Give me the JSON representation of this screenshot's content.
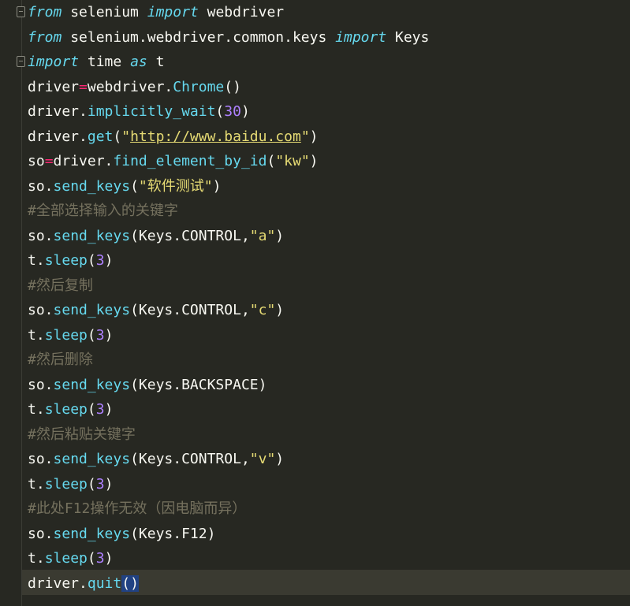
{
  "editor": {
    "lines": [
      [
        {
          "t": "from",
          "c": "kw"
        },
        {
          "t": " selenium "
        },
        {
          "t": "import",
          "c": "kw"
        },
        {
          "t": " webdriver"
        }
      ],
      [
        {
          "t": "from",
          "c": "kw"
        },
        {
          "t": " selenium.webdriver.common.keys "
        },
        {
          "t": "import",
          "c": "kw"
        },
        {
          "t": " Keys"
        }
      ],
      [
        {
          "t": "import",
          "c": "kw"
        },
        {
          "t": " time "
        },
        {
          "t": "as",
          "c": "kw"
        },
        {
          "t": " t"
        }
      ],
      [
        {
          "t": "driver"
        },
        {
          "t": "=",
          "c": "op"
        },
        {
          "t": "webdriver."
        },
        {
          "t": "Chrome",
          "c": "fn"
        },
        {
          "t": "()"
        }
      ],
      [
        {
          "t": "driver."
        },
        {
          "t": "implicitly_wait",
          "c": "fn"
        },
        {
          "t": "("
        },
        {
          "t": "30",
          "c": "num"
        },
        {
          "t": ")"
        }
      ],
      [
        {
          "t": "driver."
        },
        {
          "t": "get",
          "c": "fn"
        },
        {
          "t": "("
        },
        {
          "t": "\"",
          "c": "str"
        },
        {
          "t": "http://www.baidu.com",
          "c": "url"
        },
        {
          "t": "\"",
          "c": "str"
        },
        {
          "t": ")"
        }
      ],
      [
        {
          "t": "so"
        },
        {
          "t": "=",
          "c": "op"
        },
        {
          "t": "driver."
        },
        {
          "t": "find_element_by_id",
          "c": "fn"
        },
        {
          "t": "("
        },
        {
          "t": "\"kw\"",
          "c": "str"
        },
        {
          "t": ")"
        }
      ],
      [
        {
          "t": "so."
        },
        {
          "t": "send_keys",
          "c": "fn"
        },
        {
          "t": "("
        },
        {
          "t": "\"软件测试\"",
          "c": "str"
        },
        {
          "t": ")"
        }
      ],
      [
        {
          "t": "#全部选择输入的关键字",
          "c": "cm"
        }
      ],
      [
        {
          "t": "so."
        },
        {
          "t": "send_keys",
          "c": "fn"
        },
        {
          "t": "(Keys.CONTROL,"
        },
        {
          "t": "\"a\"",
          "c": "str"
        },
        {
          "t": ")"
        }
      ],
      [
        {
          "t": "t."
        },
        {
          "t": "sleep",
          "c": "fn"
        },
        {
          "t": "("
        },
        {
          "t": "3",
          "c": "num"
        },
        {
          "t": ")"
        }
      ],
      [
        {
          "t": "#然后复制",
          "c": "cm"
        }
      ],
      [
        {
          "t": "so."
        },
        {
          "t": "send_keys",
          "c": "fn"
        },
        {
          "t": "(Keys.CONTROL,"
        },
        {
          "t": "\"c\"",
          "c": "str"
        },
        {
          "t": ")"
        }
      ],
      [
        {
          "t": "t."
        },
        {
          "t": "sleep",
          "c": "fn"
        },
        {
          "t": "("
        },
        {
          "t": "3",
          "c": "num"
        },
        {
          "t": ")"
        }
      ],
      [
        {
          "t": "#然后删除",
          "c": "cm"
        }
      ],
      [
        {
          "t": "so."
        },
        {
          "t": "send_keys",
          "c": "fn"
        },
        {
          "t": "(Keys.BACKSPACE)"
        }
      ],
      [
        {
          "t": "t."
        },
        {
          "t": "sleep",
          "c": "fn"
        },
        {
          "t": "("
        },
        {
          "t": "3",
          "c": "num"
        },
        {
          "t": ")"
        }
      ],
      [
        {
          "t": "#然后粘贴关键字",
          "c": "cm"
        }
      ],
      [
        {
          "t": "so."
        },
        {
          "t": "send_keys",
          "c": "fn"
        },
        {
          "t": "(Keys.CONTROL,"
        },
        {
          "t": "\"v\"",
          "c": "str"
        },
        {
          "t": ")"
        }
      ],
      [
        {
          "t": "t."
        },
        {
          "t": "sleep",
          "c": "fn"
        },
        {
          "t": "("
        },
        {
          "t": "3",
          "c": "num"
        },
        {
          "t": ")"
        }
      ],
      [
        {
          "t": "#此处F12操作无效（因电脑而异）",
          "c": "cm"
        }
      ],
      [
        {
          "t": "so."
        },
        {
          "t": "send_keys",
          "c": "fn"
        },
        {
          "t": "(Keys.F12)"
        }
      ],
      [
        {
          "t": "t."
        },
        {
          "t": "sleep",
          "c": "fn"
        },
        {
          "t": "("
        },
        {
          "t": "3",
          "c": "num"
        },
        {
          "t": ")"
        }
      ],
      [
        {
          "t": "driver."
        },
        {
          "t": "quit",
          "c": "fn"
        },
        {
          "t": "(",
          "c": "sel"
        },
        {
          "t": ")",
          "c": "sel"
        }
      ]
    ],
    "current_line_index": 23
  },
  "colors": {
    "background": "#272822",
    "keyword": "#66d9ef",
    "number": "#ae81ff",
    "string": "#e6db74",
    "operator": "#f92672",
    "comment": "#75715e",
    "selection": "#214283"
  }
}
